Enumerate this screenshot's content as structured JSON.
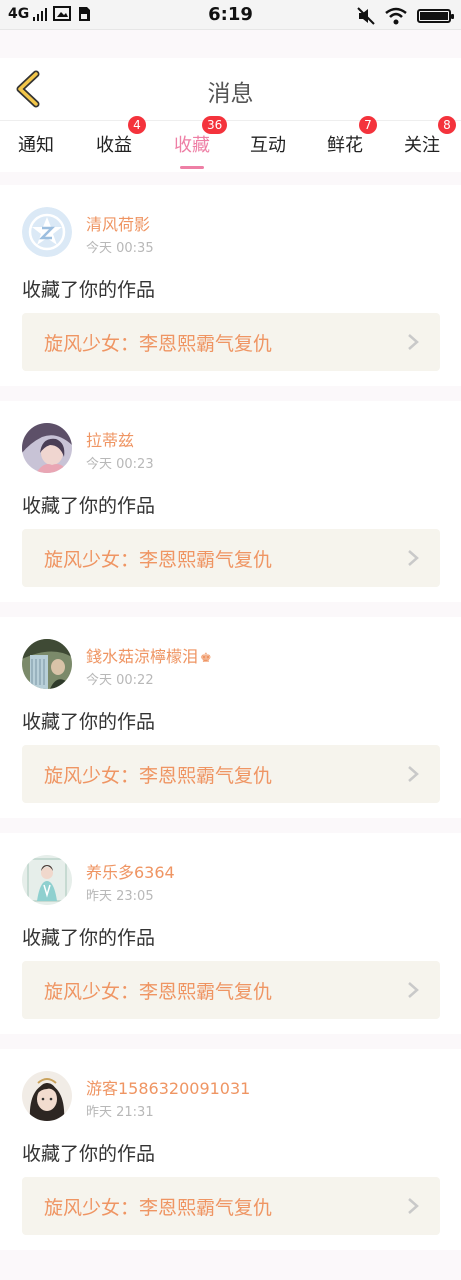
{
  "status_bar": {
    "network": "4G",
    "time": "6:19"
  },
  "header": {
    "title": "消息"
  },
  "tabs": [
    {
      "label": "通知",
      "badge": ""
    },
    {
      "label": "收益",
      "badge": "4"
    },
    {
      "label": "收藏",
      "badge": "36"
    },
    {
      "label": "互动",
      "badge": ""
    },
    {
      "label": "鲜花",
      "badge": "7"
    },
    {
      "label": "关注",
      "badge": "8"
    }
  ],
  "active_tab": "收藏",
  "colors": {
    "accent_pink": "#ee7fa5",
    "name_orange": "#ef9563",
    "badge_red": "#f4333c",
    "work_bg": "#f6f4ed"
  },
  "messages": [
    {
      "user": "清风荷影",
      "time": "今天 00:35",
      "action": "收藏了你的作品",
      "work": "旋风少女：李恩熙霸气复仇",
      "avatar": "default-z-avatar"
    },
    {
      "user": "拉蒂兹",
      "time": "今天 00:23",
      "action": "收藏了你的作品",
      "work": "旋风少女：李恩熙霸气复仇",
      "avatar": "photo-avatar"
    },
    {
      "user": "錢水菇涼檸檬泪",
      "time": "今天 00:22",
      "action": "收藏了你的作品",
      "work": "旋风少女：李恩熙霸气复仇",
      "avatar": "photo-avatar",
      "crown_icon": "♚"
    },
    {
      "user": "养乐多6364",
      "time": "昨天 23:05",
      "action": "收藏了你的作品",
      "work": "旋风少女：李恩熙霸气复仇",
      "avatar": "photo-avatar"
    },
    {
      "user": "游客1586320091031",
      "time": "昨天 21:31",
      "action": "收藏了你的作品",
      "work": "旋风少女：李恩熙霸气复仇",
      "avatar": "photo-avatar"
    }
  ]
}
